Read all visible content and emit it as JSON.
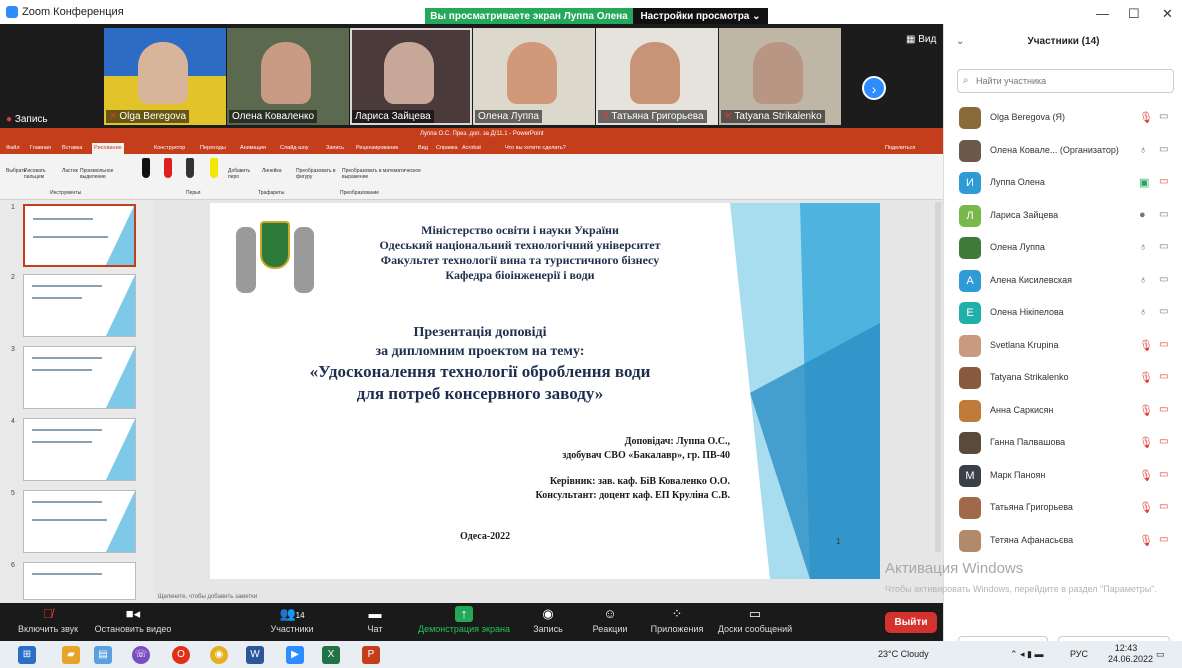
{
  "window": {
    "title": "Zoom Конференция",
    "share_banner": "Вы просматриваете экран Луппа Олена",
    "view_settings": "Настройки просмотра ⌄",
    "minimize": "—",
    "maximize": "☐",
    "close": "✕"
  },
  "video_strip": {
    "tiles": [
      {
        "name": "Olga Beregova",
        "muted": true
      },
      {
        "name": "Олена Коваленко",
        "muted": false
      },
      {
        "name": "Лариса Зайцева",
        "muted": false
      },
      {
        "name": "Олена Луппа",
        "muted": false
      },
      {
        "name": "Татьяна Григорьева",
        "muted": true
      },
      {
        "name": "Tatyana Strikalenko",
        "muted": true
      }
    ],
    "view_label": "Вид",
    "record_label": "Запись"
  },
  "powerpoint": {
    "title": "Луппа О.С. През. доп. за Д/11.1 - PowerPoint",
    "tabs": [
      "Файл",
      "Главная",
      "Вставка",
      "Рисование",
      "Конструктор",
      "Переходы",
      "Анимация",
      "Слайд-шоу",
      "Запись",
      "Рецензирование",
      "Вид",
      "Справка",
      "Acrobat",
      "Что вы хотите сделать?"
    ],
    "active_tab": "Рисование",
    "share_label": "Поделиться",
    "ribbon_groups": [
      "Инструменты",
      "Перья",
      "Трафареты",
      "Преобразование"
    ],
    "ribbon_tools": [
      "Выбрать",
      "Рисовать пальцем",
      "Ластик",
      "Произвольное выделение",
      "Добавить перо",
      "Линейка",
      "Преобразовать в фигуру",
      "Преобразовать в математическое выражение"
    ],
    "notes_hint": "Щелкните, чтобы добавить заметки",
    "slide_numbers": [
      "1",
      "2",
      "3",
      "4",
      "5",
      "6"
    ]
  },
  "slide": {
    "ministry": "Міністерство освіти і науки України",
    "university": "Одеський національний технологічний університет",
    "faculty": "Факультет технології вина та туристичного бізнесу",
    "department": "Кафедра біоінженерії і води",
    "presentation": "Презентація доповіді",
    "subtitle": "за дипломним проектом на тему:",
    "topic_line1": "«Удосконалення технології оброблення води",
    "topic_line2": "для потреб консервного заводу»",
    "speaker": "Доповідач: Луппа О.С.,",
    "speaker_detail": "здобувач СВО «Бакалавр», гр. ПВ-40",
    "supervisor": "Керівник: зав. каф. БіВ Коваленко О.О.",
    "consultant": "Консультант: доцент каф. ЕП Круліна С.В.",
    "city_year": "Одеса-2022",
    "page_number": "1"
  },
  "toolbar": {
    "mute": "Включить звук",
    "video": "Остановить видео",
    "participants": "Участники",
    "participants_count": "14",
    "chat": "Чат",
    "share": "Демонстрация экрана",
    "record": "Запись",
    "reactions": "Реакции",
    "apps": "Приложения",
    "whiteboard": "Доски сообщений",
    "leave": "Выйти"
  },
  "panel": {
    "title": "Участники (14)",
    "search_placeholder": "Найти участника",
    "participants": [
      {
        "name": "Olga Beregova (Я)",
        "avatar": "",
        "color": "#8a6a3a",
        "mic": "muted",
        "cam": "off"
      },
      {
        "name": "Олена Ковале... (Организатор)",
        "avatar": "",
        "color": "#6b5a4a",
        "mic": "on",
        "cam": "off"
      },
      {
        "name": "Луппа Олена",
        "avatar": "И",
        "color": "#2e9ad6",
        "mic": "share",
        "cam": "off-red"
      },
      {
        "name": "Лариса Зайцева",
        "avatar": "Л",
        "color": "#79b84a",
        "mic": "active",
        "cam": "off"
      },
      {
        "name": "Олена Луппа",
        "avatar": "",
        "color": "#3f7a3a",
        "mic": "on",
        "cam": "off"
      },
      {
        "name": "Алена Кисилевская",
        "avatar": "А",
        "color": "#2e9ad6",
        "mic": "on",
        "cam": "off"
      },
      {
        "name": "Олена Нікіпелова",
        "avatar": "Е",
        "color": "#21b0a8",
        "mic": "on",
        "cam": "off"
      },
      {
        "name": "Svetlana Krupina",
        "avatar": "",
        "color": "#c99a80",
        "mic": "muted",
        "cam": "off-red"
      },
      {
        "name": "Tatyana Strikalenko",
        "avatar": "",
        "color": "#8a5a40",
        "mic": "muted",
        "cam": "off-red"
      },
      {
        "name": "Анна Саркисян",
        "avatar": "",
        "color": "#c07a3a",
        "mic": "muted",
        "cam": "off-red"
      },
      {
        "name": "Ганна Палвашова",
        "avatar": "",
        "color": "#5a4a3a",
        "mic": "muted",
        "cam": "off-red"
      },
      {
        "name": "Марк Паноян",
        "avatar": "М",
        "color": "#3a3f4a",
        "mic": "muted",
        "cam": "off-red"
      },
      {
        "name": "Татьяна Григорьева",
        "avatar": "",
        "color": "#a06a4a",
        "mic": "muted",
        "cam": "off-red"
      },
      {
        "name": "Тетяна Афанасьєва",
        "avatar": "",
        "color": "#b08a6a",
        "mic": "muted",
        "cam": "off-red"
      }
    ],
    "invite": "Пригласить",
    "unmute_self": "Включить свой звук",
    "activate_title": "Активация Windows",
    "activate_text": "Чтобы активировать Windows, перейдите в раздел \"Параметры\"."
  },
  "taskbar": {
    "weather": "23°C  Cloudy",
    "lang": "РУС",
    "time": "12:43",
    "date": "24.06.2022"
  }
}
